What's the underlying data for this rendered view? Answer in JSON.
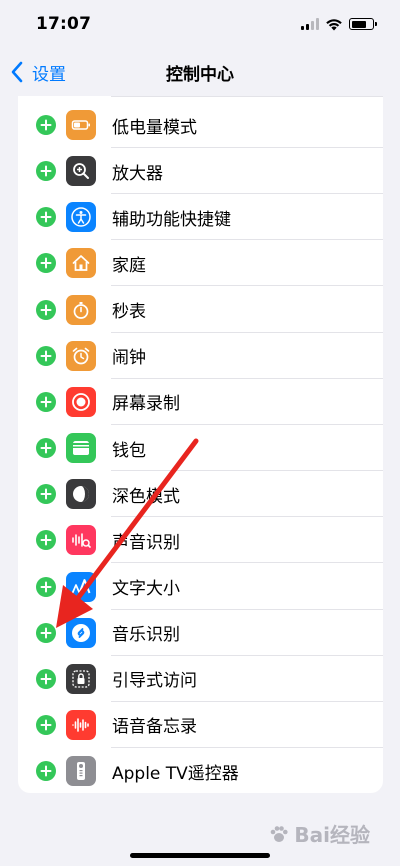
{
  "status_bar": {
    "time": "17:07"
  },
  "nav": {
    "back_label": "设置",
    "title": "控制中心"
  },
  "items": [
    {
      "label": "低电量模式",
      "icon": "battery-icon",
      "color": "#f09a37"
    },
    {
      "label": "放大器",
      "icon": "magnifier-icon",
      "color": "#3a3a3c"
    },
    {
      "label": "辅助功能快捷键",
      "icon": "accessibility-icon",
      "color": "#0a84ff"
    },
    {
      "label": "家庭",
      "icon": "home-icon",
      "color": "#f09a37"
    },
    {
      "label": "秒表",
      "icon": "stopwatch-icon",
      "color": "#f09a37"
    },
    {
      "label": "闹钟",
      "icon": "alarm-icon",
      "color": "#f09a37"
    },
    {
      "label": "屏幕录制",
      "icon": "screen-record-icon",
      "color": "#ff3b30"
    },
    {
      "label": "钱包",
      "icon": "wallet-icon",
      "color": "#34c759"
    },
    {
      "label": "深色模式",
      "icon": "dark-mode-icon",
      "color": "#3a3a3c"
    },
    {
      "label": "声音识别",
      "icon": "sound-recognition-icon",
      "color": "#ff375f"
    },
    {
      "label": "文字大小",
      "icon": "text-size-icon",
      "color": "#0a84ff"
    },
    {
      "label": "音乐识别",
      "icon": "shazam-icon",
      "color": "#0a84ff"
    },
    {
      "label": "引导式访问",
      "icon": "guided-access-icon",
      "color": "#3a3a3c"
    },
    {
      "label": "语音备忘录",
      "icon": "voice-memo-icon",
      "color": "#ff3b30"
    },
    {
      "label": "Apple TV遥控器",
      "icon": "apple-tv-remote-icon",
      "color": "#8e8e93"
    }
  ],
  "watermark": {
    "text": "Bai经验"
  },
  "colors": {
    "accent": "#007aff",
    "add": "#34c759",
    "arrow": "#e8251f"
  }
}
